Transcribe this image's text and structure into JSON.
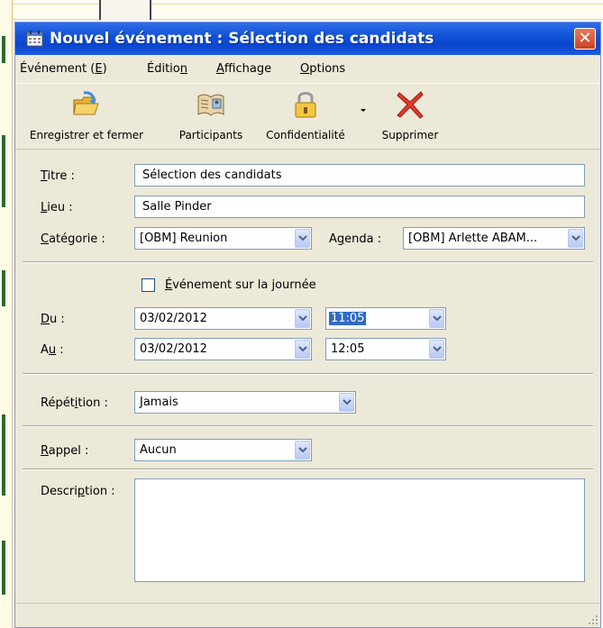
{
  "window": {
    "title": "Nouvel événement : Sélection des candidats",
    "close_label": "✕"
  },
  "menu": {
    "event": {
      "before": "Événement (",
      "key": "E",
      "after": ")"
    },
    "edit": {
      "before": "Éditio",
      "key": "n",
      "after": ""
    },
    "view": {
      "before": "",
      "key": "A",
      "after": "ffichage"
    },
    "options": {
      "before": "",
      "key": "O",
      "after": "ptions"
    }
  },
  "toolbar": {
    "save_close": "Enregistrer et fermer",
    "participants": "Participants",
    "privacy": "Confidentialité",
    "delete": "Supprimer"
  },
  "form": {
    "title_label": {
      "key": "T",
      "rest": "itre :"
    },
    "title_value": "Sélection des candidats",
    "location_label": {
      "key": "L",
      "rest": "ieu :"
    },
    "location_value": "Salle Pinder",
    "category_label": {
      "key": "C",
      "rest": "atégorie :"
    },
    "category_value": "[OBM] Reunion",
    "agenda_label": {
      "before": "A",
      "key": "g",
      "rest": "enda :"
    },
    "agenda_value": "[OBM] Arlette ABAM...",
    "allday_label": {
      "key": "É",
      "rest": "vénement sur la journée"
    },
    "from_label": {
      "key": "D",
      "rest": "u :"
    },
    "from_date": "03/02/2012",
    "from_time": "11:05",
    "to_label": {
      "before": "A",
      "key": "u",
      "rest": " :"
    },
    "to_date": "03/02/2012",
    "to_time": "12:05",
    "repeat_label": {
      "before": "Répét",
      "key": "i",
      "rest": "tion :"
    },
    "repeat_value": "Jamais",
    "reminder_label": {
      "key": "R",
      "rest": "appel :"
    },
    "reminder_value": "Aucun",
    "description_label": {
      "before": "Descri",
      "key": "p",
      "rest": "tion :"
    },
    "description_value": ""
  }
}
